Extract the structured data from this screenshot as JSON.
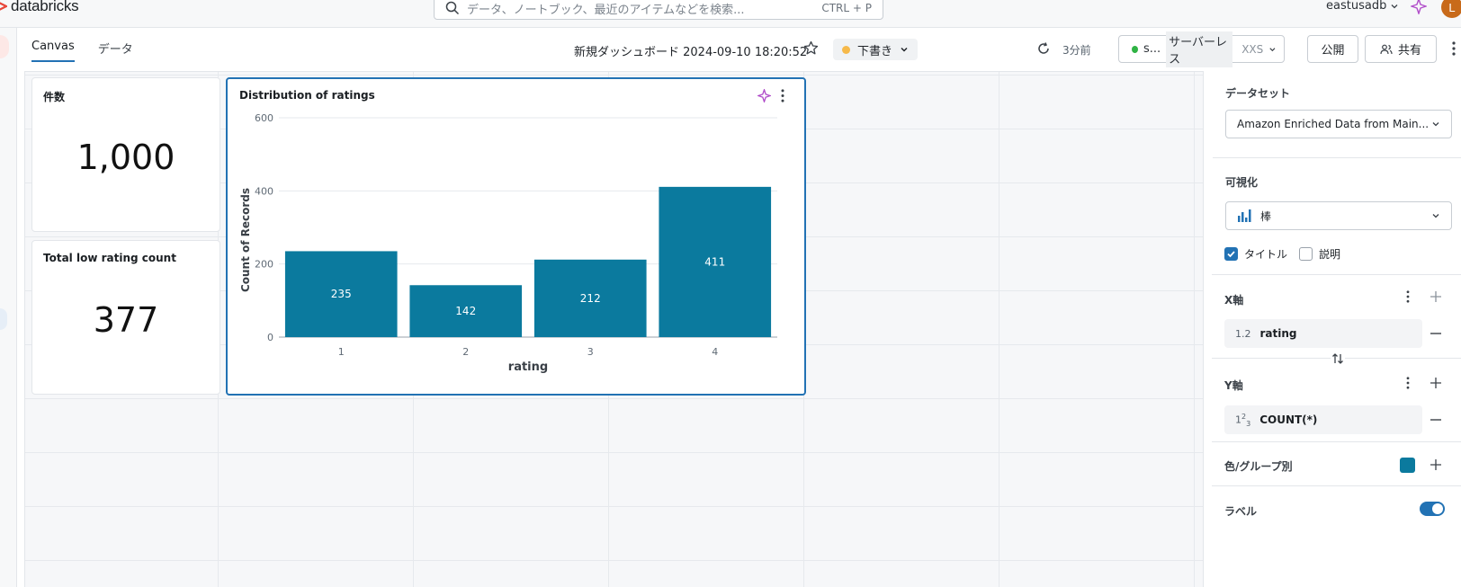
{
  "app": {
    "name": "databricks",
    "workspace": "eastusadb",
    "avatar_initial": "L"
  },
  "search": {
    "placeholder": "データ、ノートブック、最近のアイテムなどを検索...",
    "shortcut": "CTRL + P"
  },
  "tabs": [
    {
      "label": "Canvas",
      "active": true
    },
    {
      "label": "データ",
      "active": false
    }
  ],
  "dashboard": {
    "title": "新規ダッシュボード 2024-09-10 18:20:52",
    "status": "下書き",
    "last_refresh": "3分前",
    "warehouse": {
      "name": "s...",
      "type": "サーバーレス",
      "size": "XXS"
    },
    "publish_label": "公開",
    "share_label": "共有"
  },
  "widgets": {
    "count": {
      "title": "件数",
      "value": "1,000"
    },
    "low_rating": {
      "title": "Total low rating count",
      "value": "377"
    },
    "chart": {
      "title": "Distribution of ratings"
    }
  },
  "chart_data": {
    "type": "bar",
    "categories": [
      "1",
      "2",
      "3",
      "4"
    ],
    "values": [
      235,
      142,
      212,
      411
    ],
    "data_labels": [
      "235",
      "142",
      "212",
      "411"
    ],
    "xlabel": "rating",
    "ylabel": "Count of Records",
    "ylim": [
      0,
      600
    ],
    "yticks": [
      0,
      200,
      400,
      600
    ],
    "grid": true,
    "color": "#0b7a9e"
  },
  "panel": {
    "dataset_label": "データセット",
    "dataset_value": "Amazon Enriched Data from Main...",
    "viz_label": "可視化",
    "viz_value": "棒",
    "title_checkbox": {
      "label": "タイトル",
      "checked": true
    },
    "desc_checkbox": {
      "label": "説明",
      "checked": false
    },
    "x_axis_label": "X軸",
    "x_field": {
      "type": "1.2",
      "name": "rating"
    },
    "y_axis_label": "Y軸",
    "y_field": {
      "type": "123",
      "name": "COUNT(*)"
    },
    "color_label": "色/グループ別",
    "color_value": "#0b7a9e",
    "labels_label": "ラベル",
    "labels_on": true
  }
}
